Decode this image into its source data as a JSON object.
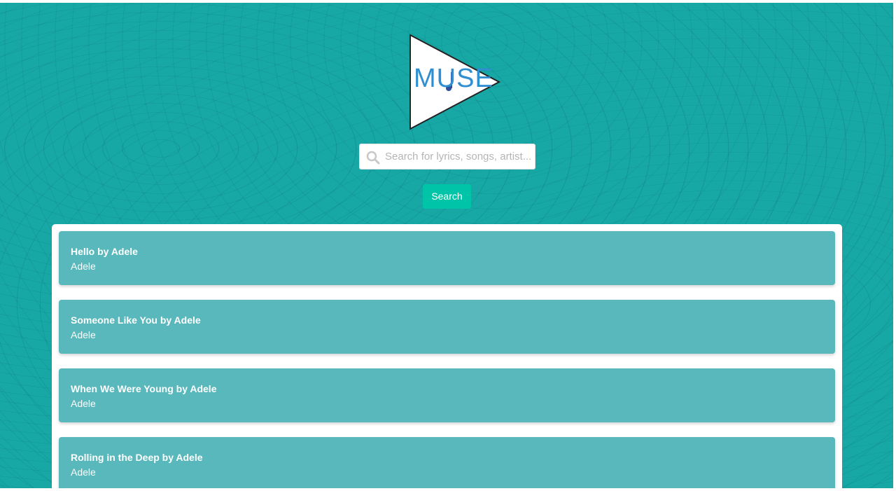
{
  "logo": {
    "text": "MUSE",
    "icon": "play-triangle-logo"
  },
  "search": {
    "placeholder": "Search for lyrics, songs, artist...",
    "value": "",
    "icon": "search-icon",
    "button_label": "Search"
  },
  "colors": {
    "background": "#17a8a6",
    "accent": "#00c4a7",
    "card": "#58b8bb"
  },
  "results": [
    {
      "title": "Hello by Adele",
      "artist": "Adele"
    },
    {
      "title": "Someone Like You by Adele",
      "artist": "Adele"
    },
    {
      "title": "When We Were Young by Adele",
      "artist": "Adele"
    },
    {
      "title": "Rolling in the Deep by Adele",
      "artist": "Adele"
    }
  ]
}
